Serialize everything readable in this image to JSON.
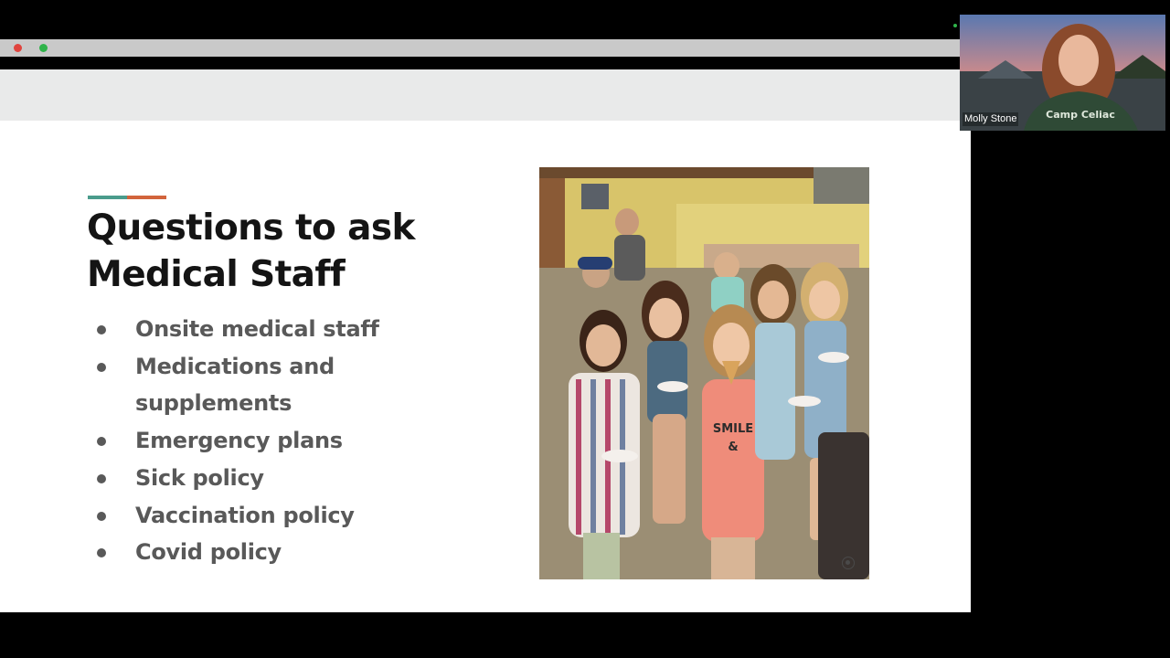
{
  "window": {
    "dots": [
      {
        "name": "close",
        "color": "#e0443e"
      },
      {
        "name": "minimize",
        "color": "#c9c9c9"
      },
      {
        "name": "maximize",
        "color": "#2fb34a"
      }
    ]
  },
  "slide": {
    "accent_colors": [
      "#4a9c8c",
      "#d2643c"
    ],
    "title_lines": [
      "Questions to ask",
      "Medical Staff"
    ],
    "bullets": [
      "Onsite medical staff",
      "Medications and supplements",
      "Emergency plans",
      "Sick policy",
      "Vaccination policy",
      "Covid policy"
    ],
    "photo_icon": "camera-icon"
  },
  "video": {
    "participant_name": "Molly Stone",
    "shirt_text": "Camp Celiac"
  }
}
